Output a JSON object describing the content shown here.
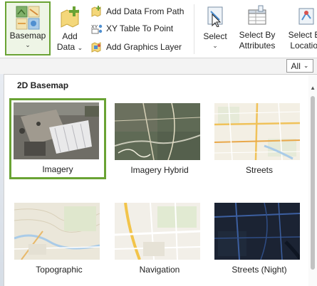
{
  "ribbon": {
    "basemap": {
      "label": "Basemap",
      "icon": "basemap-icon"
    },
    "add_data": {
      "label_line1": "Add",
      "label_line2": "Data",
      "icon": "add-data-icon"
    },
    "add_data_from_path": {
      "label": "Add Data From Path",
      "icon": "add-data-from-path-icon"
    },
    "xy_table_to_point": {
      "label": "XY Table To Point",
      "icon": "xy-table-icon"
    },
    "add_graphics_layer": {
      "label": "Add Graphics Layer",
      "icon": "graphics-layer-icon"
    },
    "select": {
      "label": "Select",
      "icon": "select-icon"
    },
    "select_by_attributes": {
      "label_line1": "Select By",
      "label_line2": "Attributes",
      "icon": "select-by-attributes-icon"
    },
    "select_by_location": {
      "label_line1": "Select By",
      "label_line2": "Location",
      "icon": "select-by-location-icon"
    }
  },
  "filter": {
    "value": "All"
  },
  "gallery": {
    "section_title": "2D Basemap",
    "tiles": [
      {
        "label": "Imagery",
        "selected": true
      },
      {
        "label": "Imagery Hybrid",
        "selected": false
      },
      {
        "label": "Streets",
        "selected": false
      },
      {
        "label": "Topographic",
        "selected": false
      },
      {
        "label": "Navigation",
        "selected": false
      },
      {
        "label": "Streets (Night)",
        "selected": false
      }
    ]
  },
  "colors": {
    "accent": "#6aa334",
    "selected_bg": "#eef5e6"
  }
}
